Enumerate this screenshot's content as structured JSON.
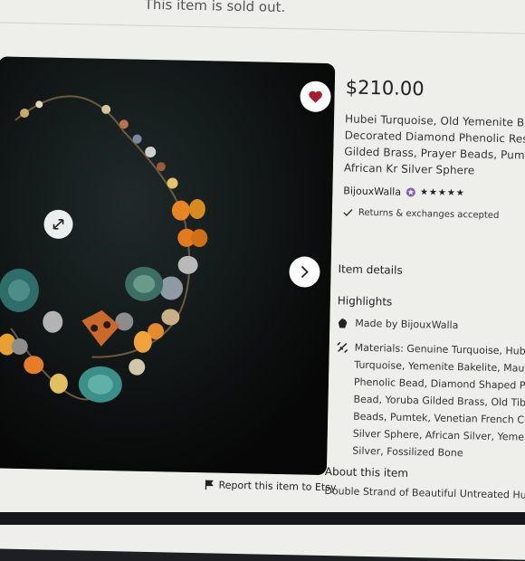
{
  "banner": {
    "sold_out": "This item is sold out."
  },
  "listing": {
    "price": "$210.00",
    "title": "Hubei Turquoise, Old Yemenite Bakelite, Decorated Diamond Phenolic Resin, Gilded Brass, Prayer Beads, Pumtek, African Kr Silver Sphere",
    "shop_name": "BijouxWalla",
    "rating_stars": "★★★★★",
    "returns": "Returns & exchanges accepted"
  },
  "details": {
    "item_details_label": "Item details",
    "highlights_label": "Highlights",
    "made_by_prefix": "Made by ",
    "made_by_shop": "BijouxWalla",
    "materials": "Materials: Genuine Turquoise, Hubei Turquoise, Yemenite Bakelite, Mauritania Phenolic Bead, Diamond Shaped Phenolic Bead, Yoruba Gilded Brass, Old Tibetan Beads, Pumtek, Venetian French Cross, Silver Sphere, African Silver, Yemen Silver, Fossilized Bone",
    "about_label": "About this item",
    "about_text": "Double Strand of Beautiful Untreated Hubei"
  },
  "photo": {
    "report_link": "Report this item to Etsy"
  },
  "colors": {
    "accent_heart": "#a61d2d",
    "page_bg": "#eeeeea",
    "text": "#222222"
  },
  "icons": [
    "heart-icon",
    "expand-icon",
    "chevron-right-icon",
    "flag-icon",
    "check-icon",
    "hand-wave-icon",
    "materials-icon",
    "star-badge-icon"
  ]
}
